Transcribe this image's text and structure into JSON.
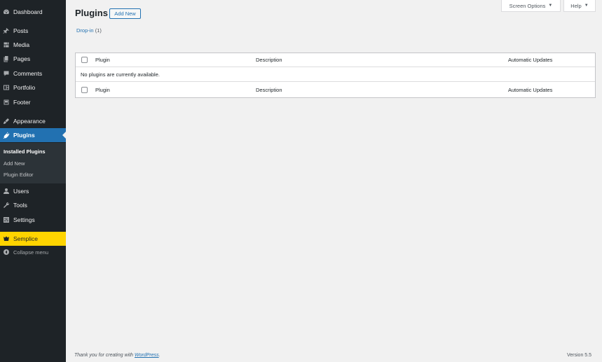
{
  "sidebar": {
    "items": [
      {
        "label": "Dashboard",
        "icon": "dashboard-icon"
      },
      {
        "label": "Posts",
        "icon": "pin-icon"
      },
      {
        "label": "Media",
        "icon": "media-icon"
      },
      {
        "label": "Pages",
        "icon": "pages-icon"
      },
      {
        "label": "Comments",
        "icon": "comment-icon"
      },
      {
        "label": "Portfolio",
        "icon": "portfolio-icon"
      },
      {
        "label": "Footer",
        "icon": "footer-icon"
      },
      {
        "label": "Appearance",
        "icon": "brush-icon"
      },
      {
        "label": "Plugins",
        "icon": "plug-icon"
      },
      {
        "label": "Users",
        "icon": "user-icon"
      },
      {
        "label": "Tools",
        "icon": "wrench-icon"
      },
      {
        "label": "Settings",
        "icon": "settings-icon"
      },
      {
        "label": "Semplice",
        "icon": "semplice-icon"
      },
      {
        "label": "Collapse menu",
        "icon": "collapse-icon"
      }
    ],
    "submenu": [
      "Installed Plugins",
      "Add New",
      "Plugin Editor"
    ]
  },
  "top": {
    "screen_options": "Screen Options",
    "help": "Help",
    "arrow": "▼"
  },
  "page": {
    "title": "Plugins",
    "add_new": "Add New",
    "filter_label": "Drop-in",
    "filter_count": "(1)"
  },
  "table": {
    "columns": [
      "Plugin",
      "Description",
      "Automatic Updates"
    ],
    "empty_message": "No plugins are currently available."
  },
  "footer": {
    "thanks_prefix": "Thank you for creating with ",
    "thanks_link": "WordPress",
    "thanks_suffix": ".",
    "version": "Version 5.5"
  },
  "colors": {
    "sidebar_bg": "#1e2327",
    "active_blue": "#2271b1",
    "semplice_yellow": "#ffd400"
  }
}
